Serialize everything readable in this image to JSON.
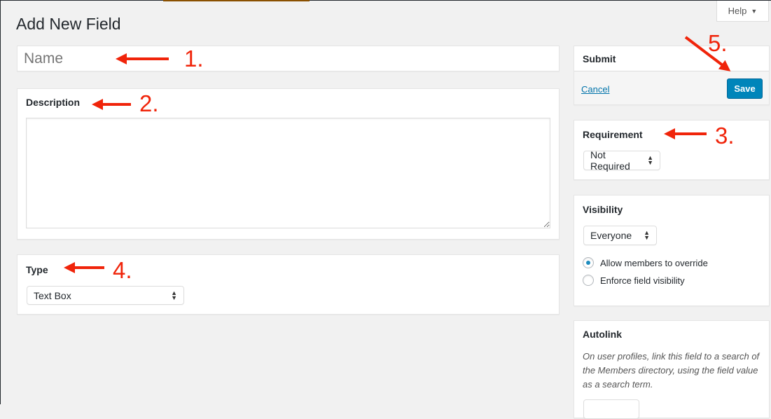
{
  "page_title": "Add New Field",
  "help_label": "Help",
  "name_placeholder": "Name",
  "description": {
    "label": "Description",
    "value": ""
  },
  "type": {
    "label": "Type",
    "selected": "Text Box"
  },
  "submit": {
    "title": "Submit",
    "cancel": "Cancel",
    "save": "Save"
  },
  "requirement": {
    "title": "Requirement",
    "selected": "Not Required"
  },
  "visibility": {
    "title": "Visibility",
    "selected": "Everyone",
    "options": [
      {
        "label": "Allow members to override",
        "checked": true
      },
      {
        "label": "Enforce field visibility",
        "checked": false
      }
    ]
  },
  "autolink": {
    "title": "Autolink",
    "description": "On user profiles, link this field to a search of the Members directory, using the field value as a search term."
  },
  "annotations": [
    "1.",
    "2.",
    "3.",
    "4.",
    "5."
  ],
  "colors": {
    "accent": "#0085ba",
    "annotation": "#f0240a"
  }
}
